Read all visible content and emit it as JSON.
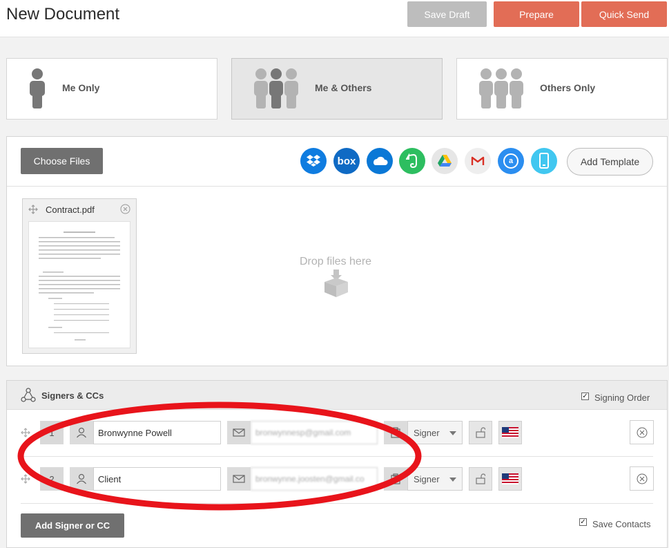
{
  "header": {
    "title": "New Document",
    "save_draft": "Save Draft",
    "prepare": "Prepare",
    "quick_send": "Quick Send"
  },
  "modes": {
    "me_only": "Me Only",
    "me_others": "Me & Others",
    "others_only": "Others Only",
    "selected": "Me & Others"
  },
  "files": {
    "choose_files": "Choose Files",
    "add_template": "Add Template",
    "cloud_sources": [
      "dropbox-icon",
      "box-icon",
      "onedrive-icon",
      "evernote-icon",
      "google-drive-icon",
      "gmail-icon",
      "amazon-icon",
      "device-icon"
    ],
    "box_text": "box",
    "drop_text": "Drop files here",
    "file_name": "Contract.pdf"
  },
  "signers": {
    "title": "Signers & CCs",
    "signing_order_label": "Signing Order",
    "signing_order_checked": true,
    "rows": [
      {
        "number": "1",
        "name": "Bronwynne Powell",
        "email": "bronwynnesp@gmail.com",
        "role": "Signer"
      },
      {
        "number": "2",
        "name": "Client",
        "email": "bronwynne.joosten@gmail.co",
        "role": "Signer"
      }
    ],
    "add_signer": "Add Signer or CC",
    "save_contacts_label": "Save Contacts",
    "save_contacts_checked": true
  },
  "colors": {
    "accent": "#e26d56",
    "draft": "#bdbdbd",
    "annotation": "#e8141b"
  }
}
